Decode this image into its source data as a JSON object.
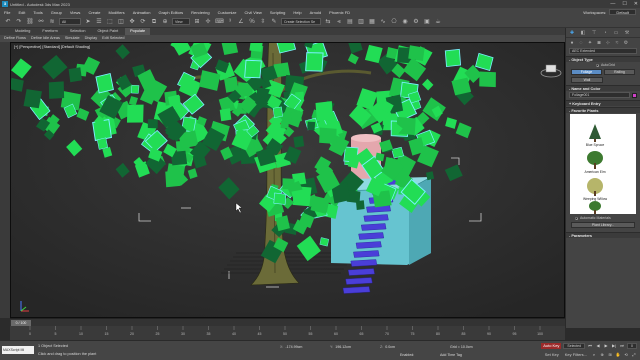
{
  "window": {
    "title": "Untitled - Autodesk 3ds Max 2023",
    "app_icon": "3",
    "controls": [
      "—",
      "☐",
      "✕"
    ]
  },
  "menu": {
    "items": [
      "File",
      "Edit",
      "Tools",
      "Group",
      "Views",
      "Create",
      "Modifiers",
      "Animation",
      "Graph Editors",
      "Rendering",
      "Customize",
      "Civil View",
      "Scripting",
      "Help",
      "Arnold",
      "Phoenix FD"
    ],
    "workspaces_label": "Workspaces:",
    "workspaces_value": "Default"
  },
  "toolbar": {
    "filter_value": "All",
    "view_value": "View",
    "named_selection": "Create Selection Se"
  },
  "ribbon": {
    "tabs": [
      "Modeling",
      "Freeform",
      "Selection",
      "Object Paint",
      "Populate"
    ],
    "active_tab": 4,
    "sub_items": [
      "Define Flows",
      "Define Idle Areas",
      "Simulate",
      "Display",
      "Edit Selected"
    ]
  },
  "viewport": {
    "label": "[+] [Perspective] [Standard] [Default Shading]",
    "colors": {
      "leaves": "#22dd55",
      "trunk": "#6b6b38",
      "box": "#66c4d0",
      "stairs": "#4a3ed8",
      "column": "#e4a7ad"
    }
  },
  "command_panel": {
    "category": "AEC Extended",
    "object_type_header": "Object Type",
    "autogrid_label": "AutoGrid",
    "autogrid_checked": "✓",
    "buttons": [
      "Foliage",
      "Railing",
      "Wall"
    ],
    "active_button": 0,
    "name_color_header": "Name and Color",
    "object_name": "Foliage001",
    "keyboard_entry_header": "Keyboard Entry",
    "favorite_plants_header": "Favorite Plants",
    "plants": [
      "Blue Spruce",
      "American Elm",
      "Weeping Willow",
      ""
    ],
    "auto_materials_label": "Automatic Materials",
    "plant_library_button": "Plant Library...",
    "parameters_header": "Parameters"
  },
  "timeslider": {
    "value": "0 / 100"
  },
  "trackbar": {
    "ticks": [
      "0",
      "5",
      "10",
      "15",
      "20",
      "25",
      "30",
      "35",
      "40",
      "45",
      "50",
      "55",
      "60",
      "65",
      "70",
      "75",
      "80",
      "85",
      "90",
      "95",
      "100"
    ]
  },
  "status": {
    "maxscript": "MAXScript Mi",
    "selection": "1 Object Selected",
    "prompt": "Click and drag to position the plant",
    "x_label": "X:",
    "x_value": "-174.99cm",
    "y_label": "Y:",
    "y_value": "196.12cm",
    "z_label": "Z:",
    "z_value": "0.0cm",
    "grid": "Grid = 10.0cm",
    "add_time_tag": "Add Time Tag",
    "isolate_label": "Enabled:",
    "auto_key": "Auto Key",
    "set_key": "Set Key",
    "key_filter": "Selected",
    "key_filters_btn": "Key Filters...",
    "frame": "0"
  }
}
